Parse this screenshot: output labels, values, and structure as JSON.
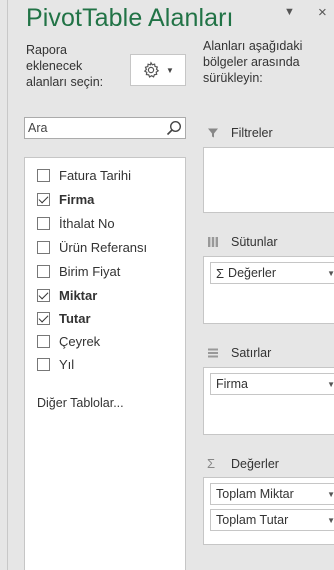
{
  "pane": {
    "title": "PivotTable Alanları",
    "dropdown_glyph": "▼",
    "close_glyph": "×",
    "choose_fields_label": "Rapora eklenecek alanları seçin:",
    "drag_fields_label": "Alanları aşağıdaki bölgeler arasında sürükleyin:"
  },
  "search": {
    "placeholder": "Ara"
  },
  "fields": [
    {
      "label": "Fatura Tarihi",
      "checked": false
    },
    {
      "label": "Firma",
      "checked": true
    },
    {
      "label": "İthalat No",
      "checked": false
    },
    {
      "label": "Ürün Referansı",
      "checked": false
    },
    {
      "label": "Birim Fiyat",
      "checked": false
    },
    {
      "label": "Miktar",
      "checked": true
    },
    {
      "label": "Tutar",
      "checked": true
    },
    {
      "label": "Çeyrek",
      "checked": false
    },
    {
      "label": "Yıl",
      "checked": false
    }
  ],
  "more_tables": "Diğer Tablolar...",
  "areas": {
    "filters": {
      "label": "Filtreler",
      "icon": "filter-icon",
      "items": []
    },
    "columns": {
      "label": "Sütunlar",
      "icon": "columns-icon",
      "items": [
        "Değerler"
      ]
    },
    "rows": {
      "label": "Satırlar",
      "icon": "rows-icon",
      "items": [
        "Firma"
      ]
    },
    "values": {
      "label": "Değerler",
      "icon": "sigma-icon",
      "items": [
        "Toplam Miktar",
        "Toplam Tutar"
      ]
    }
  },
  "colors": {
    "accent": "#217346",
    "background": "#e6e6e6"
  }
}
